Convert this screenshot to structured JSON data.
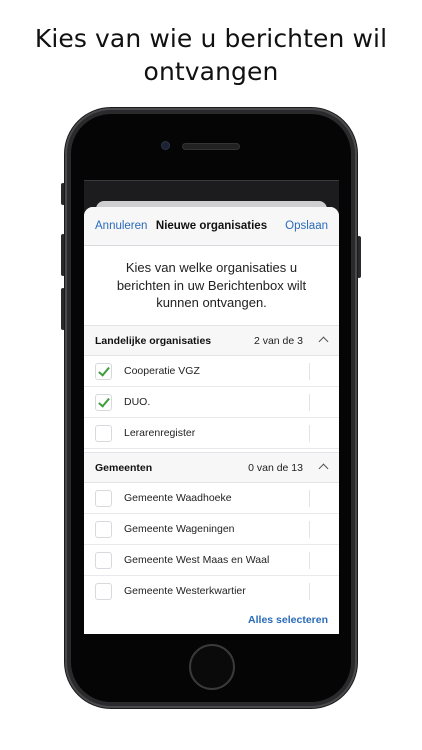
{
  "headline": "Kies van wie u berichten wil ontvangen",
  "nav": {
    "cancel": "Annuleren",
    "title": "Nieuwe organisaties",
    "save": "Opslaan"
  },
  "intro": "Kies van welke organisaties u berichten in uw Berichtenbox wilt kunnen ontvangen.",
  "sections": [
    {
      "title": "Landelijke organisaties",
      "count": "2 van de 3",
      "items": [
        {
          "label": "Cooperatie VGZ",
          "checked": true
        },
        {
          "label": "DUO.",
          "checked": true
        },
        {
          "label": "Lerarenregister",
          "checked": false
        }
      ]
    },
    {
      "title": "Gemeenten",
      "count": "0 van de 13",
      "items": [
        {
          "label": "Gemeente Waadhoeke",
          "checked": false
        },
        {
          "label": "Gemeente Wageningen",
          "checked": false
        },
        {
          "label": "Gemeente West Maas en Waal",
          "checked": false
        },
        {
          "label": "Gemeente Westerkwartier",
          "checked": false
        }
      ]
    }
  ],
  "footer": {
    "select_all": "Alles selecteren"
  },
  "colors": {
    "accent": "#2a6bb8",
    "check": "#3e9e3e"
  }
}
